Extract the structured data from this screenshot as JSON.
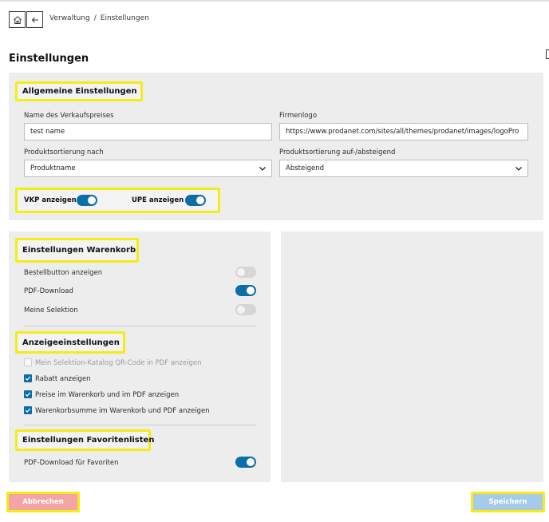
{
  "header": {
    "breadcrumb": [
      "Verwaltung",
      "Einstellungen"
    ],
    "breadcrumb_separator": "/"
  },
  "page_title": "Einstellungen",
  "general": {
    "heading": "Allgemeine Einstellungen",
    "vkp_name_label": "Name des Verkaufspreises",
    "vkp_name_value": "test name",
    "logo_label": "Firmenlogo",
    "logo_value": "https://www.prodanet.com/sites/all/themes/prodanet/images/logoPro",
    "sort_label": "Produktsortierung nach",
    "sort_value": "Produktname",
    "sort_dir_label": "Produktsortierung auf-/absteigend",
    "sort_dir_value": "Absteigend",
    "vkp_toggle_label": "VKP anzeigen",
    "vkp_toggle_on": true,
    "upe_toggle_label": "UPE anzeigen",
    "upe_toggle_on": true
  },
  "cart": {
    "heading": "Einstellungen Warenkorb",
    "items": [
      {
        "label": "Bestellbutton anzeigen",
        "on": false
      },
      {
        "label": "PDF-Download",
        "on": true
      },
      {
        "label": "Meine Selektion",
        "on": false
      }
    ]
  },
  "display": {
    "heading": "Anzeigeeinstellungen",
    "items": [
      {
        "label": "Mein Selektion-Katalog QR-Code in PDF anzeigen",
        "checked": false,
        "disabled": true
      },
      {
        "label": "Rabatt anzeigen",
        "checked": true,
        "disabled": false
      },
      {
        "label": "Preise im Warenkorb und im PDF anzeigen",
        "checked": true,
        "disabled": false
      },
      {
        "label": "Warenkorbsumme im Warenkorb und PDF anzeigen",
        "checked": true,
        "disabled": false
      }
    ]
  },
  "favorites": {
    "heading": "Einstellungen Favoritenlisten",
    "items": [
      {
        "label": "PDF-Download für Favoriten",
        "on": true
      }
    ]
  },
  "actions": {
    "cancel_label": "Abbrechen",
    "save_label": "Speichern"
  },
  "colors": {
    "accent": "#0a6ea8",
    "highlight": "#f5ec17",
    "cancel": "#f4a4a6",
    "save": "#a6cbe8",
    "panel": "#ededed"
  }
}
